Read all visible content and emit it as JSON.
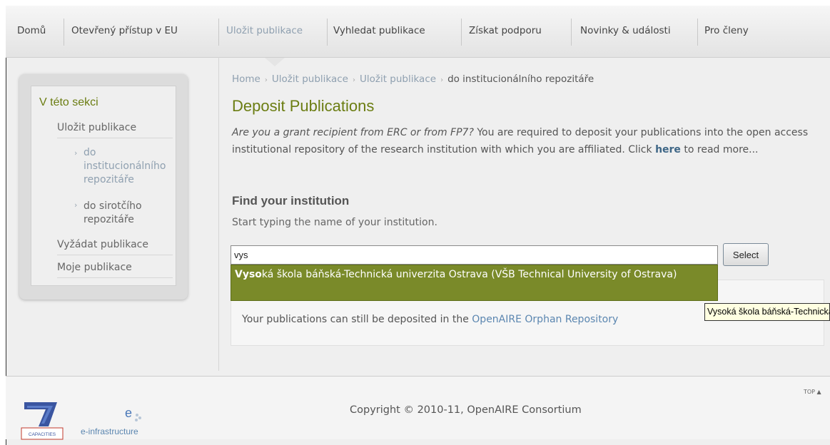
{
  "nav": {
    "items": [
      {
        "label": "Domů"
      },
      {
        "label": "Otevřený přístup v EU"
      },
      {
        "label": "Uložit publikace"
      },
      {
        "label": "Vyhledat publikace"
      },
      {
        "label": "Získat podporu"
      },
      {
        "label": "Novinky & události"
      },
      {
        "label": "Pro členy"
      }
    ],
    "active_index": 2
  },
  "sidebar": {
    "title": "V této sekci",
    "items": [
      {
        "label": "Uložit publikace"
      },
      {
        "label": "Vyžádat publikace"
      },
      {
        "label": "Moje publikace"
      }
    ],
    "subitems": [
      {
        "label_1": "do",
        "label_2": "institucionálního",
        "label_3": "repozitáře"
      },
      {
        "label_1": "do sirotčího",
        "label_2": "repozitáře"
      }
    ]
  },
  "breadcrumb": {
    "items": [
      "Home",
      "Uložit publikace",
      "Uložit publikace",
      "do institucionálního repozitáře"
    ]
  },
  "main": {
    "title": "Deposit Publications",
    "intro_em": "Are you a grant recipient from ERC or from FP7?",
    "intro_text_1": " You are required to deposit your publications into the open access institutional repository of the research institution with which you are affiliated. Click ",
    "intro_link": "here",
    "intro_text_2": " to read more...",
    "find_heading": "Find your institution",
    "find_hint": "Start typing the name of your institution.",
    "search_value": "vys",
    "select_label": "Select",
    "suggestion_match": "Vyso",
    "suggestion_rest": "ká škola báňská-Technická univerzita Ostrava (VŠB Technical University of Ostrava)",
    "result_text": "Your publications can still be deposited in the ",
    "result_link": "OpenAIRE Orphan Repository",
    "tooltip": "Vysoká škola báňská-Technická univerzita Ostrava"
  },
  "footer": {
    "copyright": "Copyright © 2010-11, OpenAIRE Consortium",
    "top_link": "TOP ▲",
    "logo_capacities": "CAPACITIES",
    "logo_einfra": "e-infrastructure"
  },
  "colors": {
    "accent_green": "#6b7d12",
    "suggestion_bg": "#7a8a29",
    "link_blue": "#5b86b0"
  }
}
